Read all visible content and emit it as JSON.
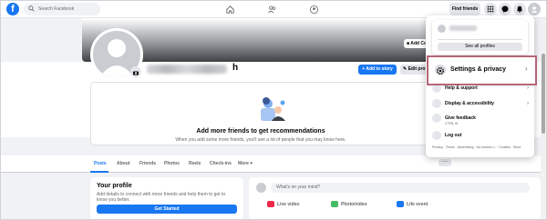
{
  "topnav": {
    "logo_letter": "f",
    "search_placeholder": "Search Facebook",
    "find_friends": "Find friends"
  },
  "profile": {
    "name_tail": "h",
    "add_to_story": "+ Add to story",
    "edit_profile": "✎ Edit profi",
    "add_cover": "■ Add Co"
  },
  "recommendations": {
    "title": "Add more friends to get recommendations",
    "subtitle": "When you add some more friends, you'll see a lot of people that you may know here."
  },
  "tabs": [
    {
      "label": "Posts",
      "active": true
    },
    {
      "label": "About"
    },
    {
      "label": "Friends"
    },
    {
      "label": "Photos"
    },
    {
      "label": "Reels"
    },
    {
      "label": "Check-ins"
    },
    {
      "label": "More ▾"
    }
  ],
  "more_button": "···",
  "your_profile": {
    "title": "Your profile",
    "description": "Add details to connect with more friends and help them to get to know you better.",
    "button": "Get Started"
  },
  "composer": {
    "placeholder": "What's on your mind?",
    "actions": [
      {
        "label": "Live video",
        "color": "#f02849"
      },
      {
        "label": "Photo/video",
        "color": "#45bd62"
      },
      {
        "label": "Life event",
        "color": "#1877f2"
      }
    ]
  },
  "menu": {
    "see_all_profiles": "See all profiles",
    "settings": "Settings & privacy",
    "items": [
      {
        "label": "Help & support",
        "chevron": "›"
      },
      {
        "label": "Display & accessibility",
        "chevron": "›"
      },
      {
        "label": "Give feedback",
        "sub": "CTRL B"
      },
      {
        "label": "Log out"
      }
    ],
    "footer": "Privacy · Terms · Advertising · Ad choices ▷ · Cookies · More"
  },
  "colors": {
    "brand": "#1877f2",
    "highlight_border": "#b56576"
  }
}
